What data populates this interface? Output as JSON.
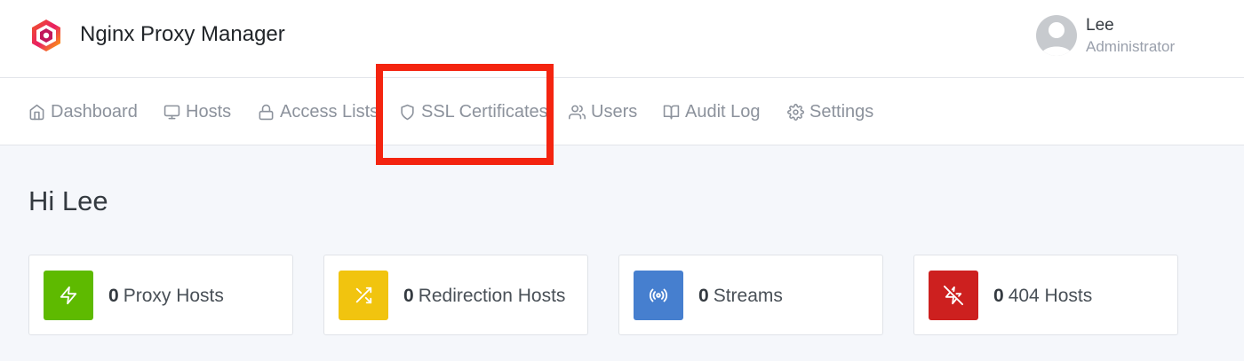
{
  "header": {
    "app_title": "Nginx Proxy Manager",
    "user": {
      "name": "Lee",
      "role": "Administrator"
    }
  },
  "nav": {
    "items": [
      {
        "label": "Dashboard",
        "icon": "home-icon"
      },
      {
        "label": "Hosts",
        "icon": "monitor-icon"
      },
      {
        "label": "Access Lists",
        "icon": "lock-icon"
      },
      {
        "label": "SSL Certificates",
        "icon": "shield-icon",
        "highlighted": true
      },
      {
        "label": "Users",
        "icon": "users-icon"
      },
      {
        "label": "Audit Log",
        "icon": "book-open-icon"
      },
      {
        "label": "Settings",
        "icon": "gear-icon"
      }
    ]
  },
  "main": {
    "greeting": "Hi Lee",
    "stats": [
      {
        "count": "0",
        "label": "Proxy Hosts",
        "icon": "zap-icon",
        "color": "#5eba00"
      },
      {
        "count": "0",
        "label": "Redirection Hosts",
        "icon": "shuffle-icon",
        "color": "#f1c40f"
      },
      {
        "count": "0",
        "label": "Streams",
        "icon": "radio-icon",
        "color": "#467fcf"
      },
      {
        "count": "0",
        "label": "404 Hosts",
        "icon": "zap-off-icon",
        "color": "#cd201f"
      }
    ]
  },
  "annotation": {
    "color": "#f42410"
  }
}
